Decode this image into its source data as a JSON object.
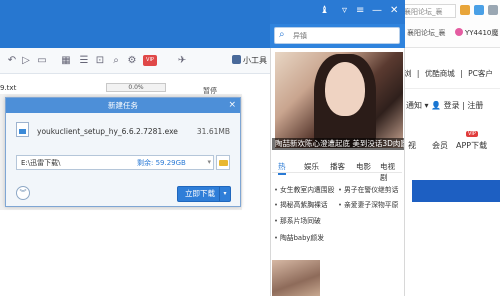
{
  "background_browser": {
    "url_text": "襄阳论坛_襄",
    "tab_label": "YY4410魔",
    "links": [
      "浏",
      "优酷商城",
      "PC客户"
    ],
    "login": "登录",
    "register": "注册",
    "notify": "通知",
    "nav": [
      "会员",
      "APP下载"
    ],
    "vip_tag": "VIP",
    "vertical_bar": "|",
    "left_label": "视"
  },
  "xunlei": {
    "file_name_partial": "9.txt",
    "progress_text": "0.0%",
    "status_text": "暂停",
    "vip_badge": "VIP",
    "tools_label": "小工具"
  },
  "side_window": {
    "search_placeholder": "异镇",
    "caption": "陶喆新欢陈心澄遭起底 美到没话3D肉圆圆",
    "tabs": [
      "热",
      "娱乐",
      "播客",
      "电影",
      "电视剧"
    ],
    "news_items": [
      "女生教室内遭围殴",
      "男子在警仪继剪话",
      "揭秘高紫胸裸话",
      "亲爱妻子深物平原",
      "那系片场同破",
      "陶喆baby颜发"
    ]
  },
  "dialog": {
    "title": "新建任务",
    "close_icon": "×",
    "file_name": "youkuclient_setup_hy_6.6.2.7281.exe",
    "file_size": "31.61MB",
    "save_path": "E:\\迅雷下载\\",
    "free_space_label": "剩余: 59.29GB",
    "download_button": "立即下载",
    "expand_icon": "chevron-down"
  }
}
